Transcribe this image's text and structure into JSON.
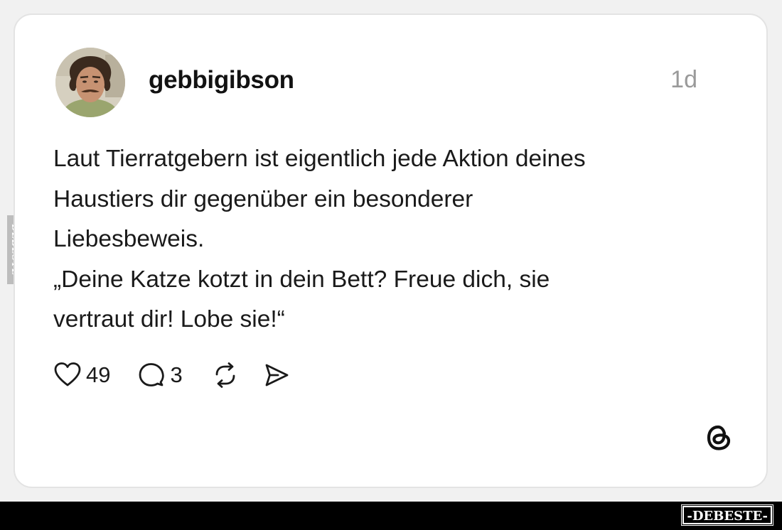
{
  "post": {
    "username": "gebbigibson",
    "timestamp": "1d",
    "text_lines": [
      "Laut Tierratgebern ist eigentlich jede Aktion deines",
      "Haustiers dir gegenüber ein besonderer",
      "Liebesbeweis.",
      "„Deine Katze kotzt in dein Bett? Freue dich, sie",
      "vertraut dir! Lobe sie!“"
    ]
  },
  "actions": {
    "likes": "49",
    "comments": "3",
    "icons": [
      "heart-icon",
      "comment-icon",
      "repost-icon",
      "share-icon"
    ]
  },
  "brand": {
    "logo": "threads-logo-icon"
  },
  "watermark": {
    "side": "DEBESTE",
    "bottom": "-DEBESTE-"
  },
  "colors": {
    "card_background": "#ffffff",
    "page_background": "#f1f1f1",
    "text": "#1a1a1a",
    "timestamp": "#9a9a9a",
    "bottom_bar": "#000000"
  }
}
